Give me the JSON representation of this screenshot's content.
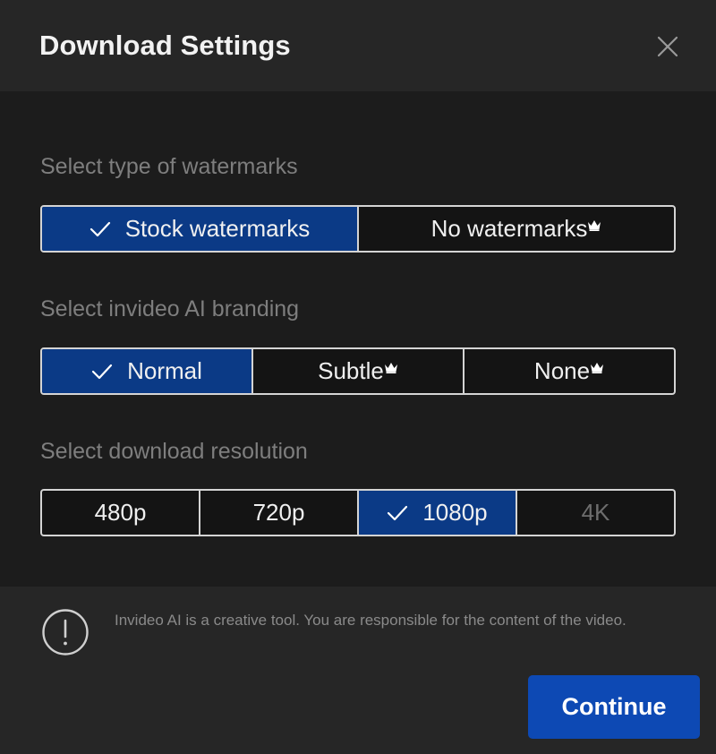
{
  "dialog": {
    "title": "Download Settings",
    "close_icon": "close-icon"
  },
  "watermarks": {
    "label": "Select type of watermarks",
    "options": [
      {
        "label": "Stock watermarks",
        "selected": true,
        "premium": false
      },
      {
        "label": "No watermarks",
        "selected": false,
        "premium": true
      }
    ]
  },
  "branding": {
    "label": "Select invideo AI branding",
    "options": [
      {
        "label": "Normal",
        "selected": true,
        "premium": false
      },
      {
        "label": "Subtle",
        "selected": false,
        "premium": true
      },
      {
        "label": "None",
        "selected": false,
        "premium": true
      }
    ]
  },
  "resolution": {
    "label": "Select download resolution",
    "options": [
      {
        "label": "480p",
        "selected": false,
        "disabled": false
      },
      {
        "label": "720p",
        "selected": false,
        "disabled": false
      },
      {
        "label": "1080p",
        "selected": true,
        "disabled": false
      },
      {
        "label": "4K",
        "selected": false,
        "disabled": true
      }
    ]
  },
  "footer": {
    "info_icon": "exclamation-circle-icon",
    "disclaimer": "Invideo AI is a creative tool. You are responsible for the content of the video.",
    "continue_label": "Continue"
  },
  "colors": {
    "accent": "#0b3a86",
    "button": "#0d49b4",
    "background": "#1c1c1c",
    "header": "#262626"
  }
}
